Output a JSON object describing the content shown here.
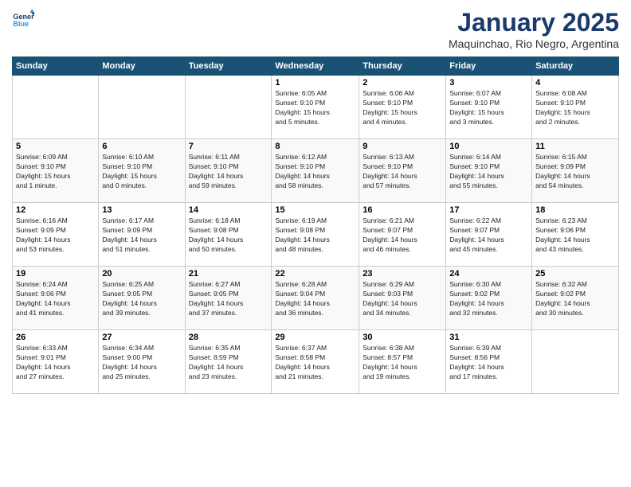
{
  "header": {
    "logo_line1": "General",
    "logo_line2": "Blue",
    "month_title": "January 2025",
    "subtitle": "Maquinchao, Rio Negro, Argentina"
  },
  "days_of_week": [
    "Sunday",
    "Monday",
    "Tuesday",
    "Wednesday",
    "Thursday",
    "Friday",
    "Saturday"
  ],
  "weeks": [
    [
      {
        "num": "",
        "info": ""
      },
      {
        "num": "",
        "info": ""
      },
      {
        "num": "",
        "info": ""
      },
      {
        "num": "1",
        "info": "Sunrise: 6:05 AM\nSunset: 9:10 PM\nDaylight: 15 hours\nand 5 minutes."
      },
      {
        "num": "2",
        "info": "Sunrise: 6:06 AM\nSunset: 9:10 PM\nDaylight: 15 hours\nand 4 minutes."
      },
      {
        "num": "3",
        "info": "Sunrise: 6:07 AM\nSunset: 9:10 PM\nDaylight: 15 hours\nand 3 minutes."
      },
      {
        "num": "4",
        "info": "Sunrise: 6:08 AM\nSunset: 9:10 PM\nDaylight: 15 hours\nand 2 minutes."
      }
    ],
    [
      {
        "num": "5",
        "info": "Sunrise: 6:09 AM\nSunset: 9:10 PM\nDaylight: 15 hours\nand 1 minute."
      },
      {
        "num": "6",
        "info": "Sunrise: 6:10 AM\nSunset: 9:10 PM\nDaylight: 15 hours\nand 0 minutes."
      },
      {
        "num": "7",
        "info": "Sunrise: 6:11 AM\nSunset: 9:10 PM\nDaylight: 14 hours\nand 59 minutes."
      },
      {
        "num": "8",
        "info": "Sunrise: 6:12 AM\nSunset: 9:10 PM\nDaylight: 14 hours\nand 58 minutes."
      },
      {
        "num": "9",
        "info": "Sunrise: 6:13 AM\nSunset: 9:10 PM\nDaylight: 14 hours\nand 57 minutes."
      },
      {
        "num": "10",
        "info": "Sunrise: 6:14 AM\nSunset: 9:10 PM\nDaylight: 14 hours\nand 55 minutes."
      },
      {
        "num": "11",
        "info": "Sunrise: 6:15 AM\nSunset: 9:09 PM\nDaylight: 14 hours\nand 54 minutes."
      }
    ],
    [
      {
        "num": "12",
        "info": "Sunrise: 6:16 AM\nSunset: 9:09 PM\nDaylight: 14 hours\nand 53 minutes."
      },
      {
        "num": "13",
        "info": "Sunrise: 6:17 AM\nSunset: 9:09 PM\nDaylight: 14 hours\nand 51 minutes."
      },
      {
        "num": "14",
        "info": "Sunrise: 6:18 AM\nSunset: 9:08 PM\nDaylight: 14 hours\nand 50 minutes."
      },
      {
        "num": "15",
        "info": "Sunrise: 6:19 AM\nSunset: 9:08 PM\nDaylight: 14 hours\nand 48 minutes."
      },
      {
        "num": "16",
        "info": "Sunrise: 6:21 AM\nSunset: 9:07 PM\nDaylight: 14 hours\nand 46 minutes."
      },
      {
        "num": "17",
        "info": "Sunrise: 6:22 AM\nSunset: 9:07 PM\nDaylight: 14 hours\nand 45 minutes."
      },
      {
        "num": "18",
        "info": "Sunrise: 6:23 AM\nSunset: 9:06 PM\nDaylight: 14 hours\nand 43 minutes."
      }
    ],
    [
      {
        "num": "19",
        "info": "Sunrise: 6:24 AM\nSunset: 9:06 PM\nDaylight: 14 hours\nand 41 minutes."
      },
      {
        "num": "20",
        "info": "Sunrise: 6:25 AM\nSunset: 9:05 PM\nDaylight: 14 hours\nand 39 minutes."
      },
      {
        "num": "21",
        "info": "Sunrise: 6:27 AM\nSunset: 9:05 PM\nDaylight: 14 hours\nand 37 minutes."
      },
      {
        "num": "22",
        "info": "Sunrise: 6:28 AM\nSunset: 9:04 PM\nDaylight: 14 hours\nand 36 minutes."
      },
      {
        "num": "23",
        "info": "Sunrise: 6:29 AM\nSunset: 9:03 PM\nDaylight: 14 hours\nand 34 minutes."
      },
      {
        "num": "24",
        "info": "Sunrise: 6:30 AM\nSunset: 9:02 PM\nDaylight: 14 hours\nand 32 minutes."
      },
      {
        "num": "25",
        "info": "Sunrise: 6:32 AM\nSunset: 9:02 PM\nDaylight: 14 hours\nand 30 minutes."
      }
    ],
    [
      {
        "num": "26",
        "info": "Sunrise: 6:33 AM\nSunset: 9:01 PM\nDaylight: 14 hours\nand 27 minutes."
      },
      {
        "num": "27",
        "info": "Sunrise: 6:34 AM\nSunset: 9:00 PM\nDaylight: 14 hours\nand 25 minutes."
      },
      {
        "num": "28",
        "info": "Sunrise: 6:35 AM\nSunset: 8:59 PM\nDaylight: 14 hours\nand 23 minutes."
      },
      {
        "num": "29",
        "info": "Sunrise: 6:37 AM\nSunset: 8:58 PM\nDaylight: 14 hours\nand 21 minutes."
      },
      {
        "num": "30",
        "info": "Sunrise: 6:38 AM\nSunset: 8:57 PM\nDaylight: 14 hours\nand 19 minutes."
      },
      {
        "num": "31",
        "info": "Sunrise: 6:39 AM\nSunset: 8:56 PM\nDaylight: 14 hours\nand 17 minutes."
      },
      {
        "num": "",
        "info": ""
      }
    ]
  ]
}
